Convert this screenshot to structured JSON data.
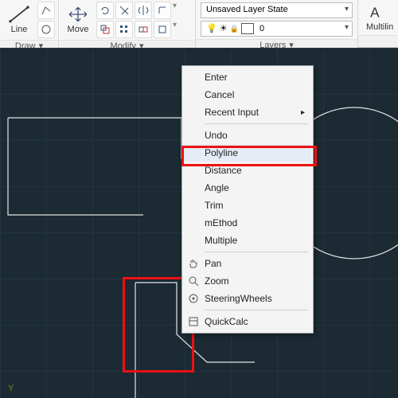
{
  "ribbon": {
    "panels": {
      "draw": {
        "title": "Draw",
        "line_label": "Line"
      },
      "modify": {
        "title": "Modify",
        "move_label": "Move"
      },
      "layers": {
        "title": "Layers",
        "state_dropdown": "Unsaved Layer State",
        "current_layer": "0"
      },
      "annotation": {
        "multiline_label": "Multilin"
      }
    }
  },
  "icons": {
    "bulb": "💡",
    "sun": "☀",
    "lock": "🔒"
  },
  "ucs": {
    "y": "Y"
  },
  "context_menu": {
    "enter": "Enter",
    "cancel": "Cancel",
    "recent_input": "Recent Input",
    "undo": "Undo",
    "polyline": "Polyline",
    "distance": "Distance",
    "angle": "Angle",
    "trim": "Trim",
    "method": "mEthod",
    "multiple": "Multiple",
    "pan": "Pan",
    "zoom": "Zoom",
    "steering": "SteeringWheels",
    "quickcalc": "QuickCalc"
  },
  "chart_data": null
}
